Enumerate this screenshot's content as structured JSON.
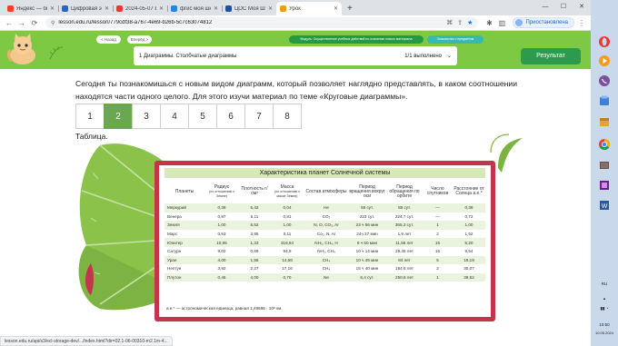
{
  "browser": {
    "tabs": [
      {
        "title": "Яндекс — быстрый",
        "color": "#fc3f1d",
        "active": false
      },
      {
        "title": "Цифровая экосисте",
        "color": "#2b62c4",
        "active": false
      },
      {
        "title": "2024-05-07 Вебинар",
        "color": "#e53935",
        "active": false
      },
      {
        "title": "фгис моя школа — У",
        "color": "#1e88e5",
        "active": false
      },
      {
        "title": "ЦОС Моя Школа",
        "color": "#1e4fa3",
        "active": false
      },
      {
        "title": "Урок",
        "color": "#f39c12",
        "active": true
      }
    ],
    "url": "lesson.edu.ru/lesson/779cdf38-a767-4e69-b26b-5c7c63074812",
    "profile_label": "Приостановлена"
  },
  "lesson_header": {
    "back_label": "< Назад",
    "forward_label": "Вперёд >",
    "module_label": "Модуль: Осуществление учебных действий по освоению нового материала",
    "status_label": "Знакомство с предметом",
    "step_title": "1 Диаграммы. Столбчатые диаграммы",
    "step_status": "1/1 выполнено",
    "result_label": "Результат"
  },
  "content": {
    "intro": "Сегодня ты познакомишься с новым видом диаграмм, который позволяет наглядно представлять, в каком соотношении находятся части одного целого. Для этого изучи материал по теме «Круговые диаграммы».",
    "pages": [
      "1",
      "2",
      "3",
      "4",
      "5",
      "6",
      "7",
      "8"
    ],
    "active_page": "2",
    "table_label": "Таблица."
  },
  "planet_table": {
    "caption": "Характеристика планет Солнечной системы",
    "headers": [
      {
        "main": "Планеты",
        "sub": ""
      },
      {
        "main": "Радиус",
        "sub": "(по отношению к Земле)"
      },
      {
        "main": "Плотность г/см³",
        "sub": ""
      },
      {
        "main": "Масса",
        "sub": "(по отношению к массе Земли)"
      },
      {
        "main": "Состав атмосферы",
        "sub": ""
      },
      {
        "main": "Период вращения вокруг оси",
        "sub": ""
      },
      {
        "main": "Период обращения по орбите",
        "sub": ""
      },
      {
        "main": "Число спутников",
        "sub": ""
      },
      {
        "main": "Расстояние от Солнца а.е.*",
        "sub": ""
      }
    ],
    "rows": [
      [
        "Меркурий",
        "0,39",
        "5,42",
        "0,04",
        "He",
        "59 сут.",
        "88 сут.",
        "—",
        "0,39"
      ],
      [
        "Венера",
        "0,97",
        "5,11",
        "0,81",
        "CO₂",
        "223 сут.",
        "224,7 сут.",
        "—",
        "0,72"
      ],
      [
        "Земля",
        "1,00",
        "5,52",
        "1,00",
        "N, O, CO₂, Ar",
        "23 ч 56 мин",
        "365,3 сут.",
        "1",
        "1,00"
      ],
      [
        "Марс",
        "0,53",
        "3,95",
        "0,11",
        "Co₂, N, Ar",
        "24ч 37 мин",
        "1,9 лет",
        "2",
        "1,52"
      ],
      [
        "Юпитер",
        "10,95",
        "1,33",
        "316,94",
        "NH₃, CH₄, H",
        "9 ч 50 мин",
        "11,86 лет",
        "15",
        "5,20"
      ],
      [
        "Сатурн",
        "9,02",
        "0,69",
        "94,9",
        "NH₃, CH₄",
        "10 ч 14 мин",
        "29,45 лет",
        "16",
        "9,54"
      ],
      [
        "Уран",
        "4,00",
        "1,56",
        "14,66",
        "CH₄",
        "10 ч 49 мин",
        "84 лет",
        "5",
        "19,19"
      ],
      [
        "Нептун",
        "3,92",
        "2,27",
        "17,16",
        "CH₄",
        "15 ч 40 мин",
        "164,8 лет",
        "2",
        "30,07"
      ],
      [
        "Плутон",
        "0,46",
        "4,00",
        "0,70",
        "Ne",
        "6,4 сут.",
        "250,6 лет",
        "1",
        "39,52"
      ]
    ],
    "note": "а.е.* — астрономическая единица, равная 1,49598 · 10⁸ км."
  },
  "statusbar": {
    "text": "lesson.edu.ru/api/s3/ecl-storage-dev/.../index.html?dir=02.1-06-00310-m2.1m-4..."
  },
  "taskbar": {
    "lang": "RU",
    "time": "10:50",
    "date": "10.05.2024"
  }
}
